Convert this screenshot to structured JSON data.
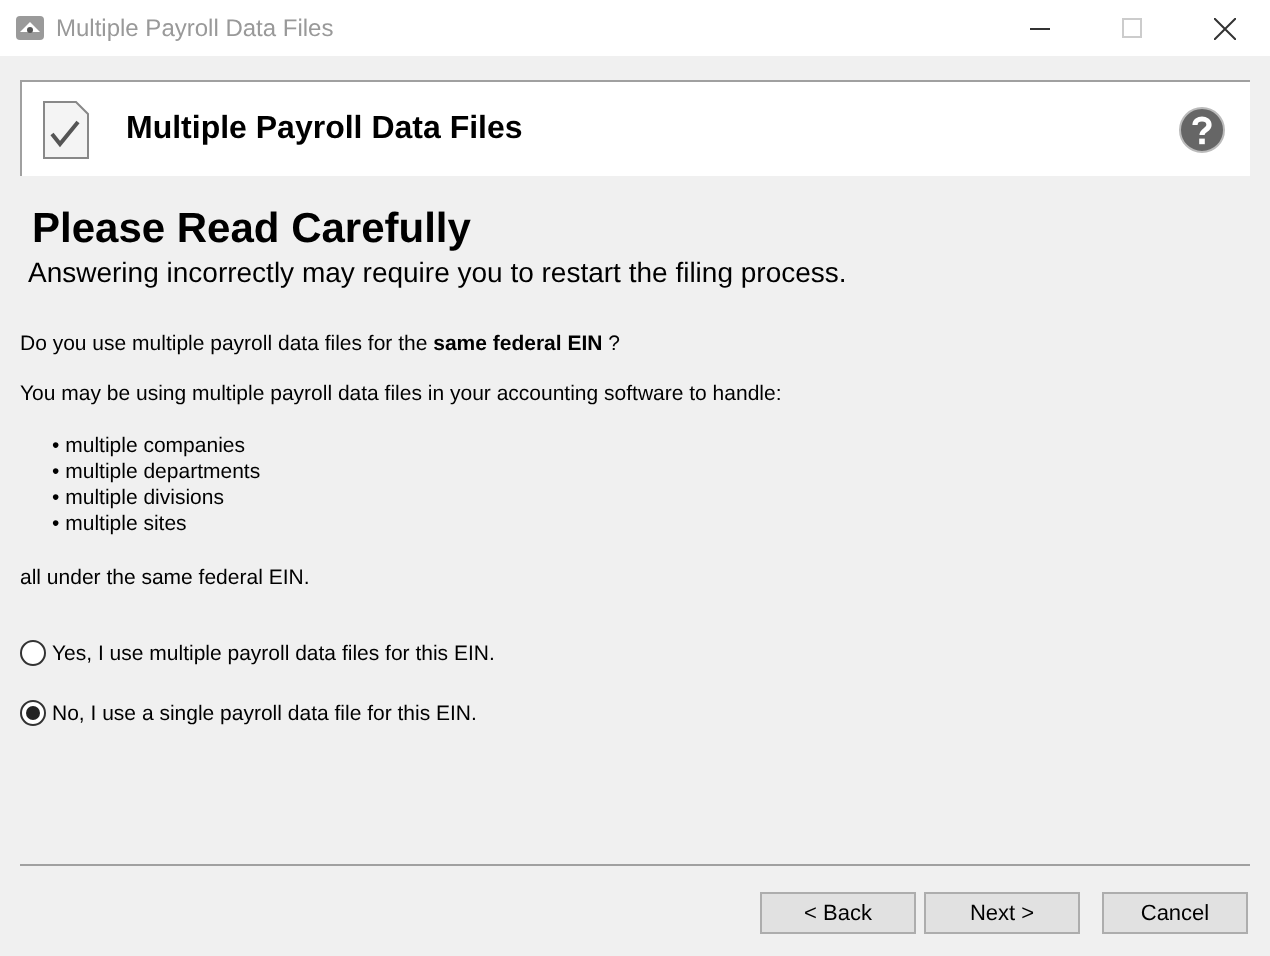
{
  "window": {
    "title": "Multiple Payroll Data Files"
  },
  "header": {
    "title": "Multiple Payroll Data Files"
  },
  "heading": "Please Read Carefully",
  "subheading": "Answering incorrectly may require you to restart the filing process.",
  "question": "Do you use multiple payroll data files for the **same federal EIN** ?",
  "intro": "You may be using multiple payroll data files in your accounting software to handle:",
  "bullets": [
    "multiple companies",
    "multiple departments",
    "multiple divisions",
    "multiple sites"
  ],
  "bullet_mark": "•",
  "outro": "all under the same federal EIN.",
  "options": [
    {
      "label": "Yes, I use multiple payroll data files for this EIN.",
      "selected": false
    },
    {
      "label": "No, I use a single payroll data file for this EIN.",
      "selected": true
    }
  ],
  "buttons": [
    {
      "label": "< Back"
    },
    {
      "label": "Next >"
    },
    {
      "label": "Cancel"
    }
  ]
}
